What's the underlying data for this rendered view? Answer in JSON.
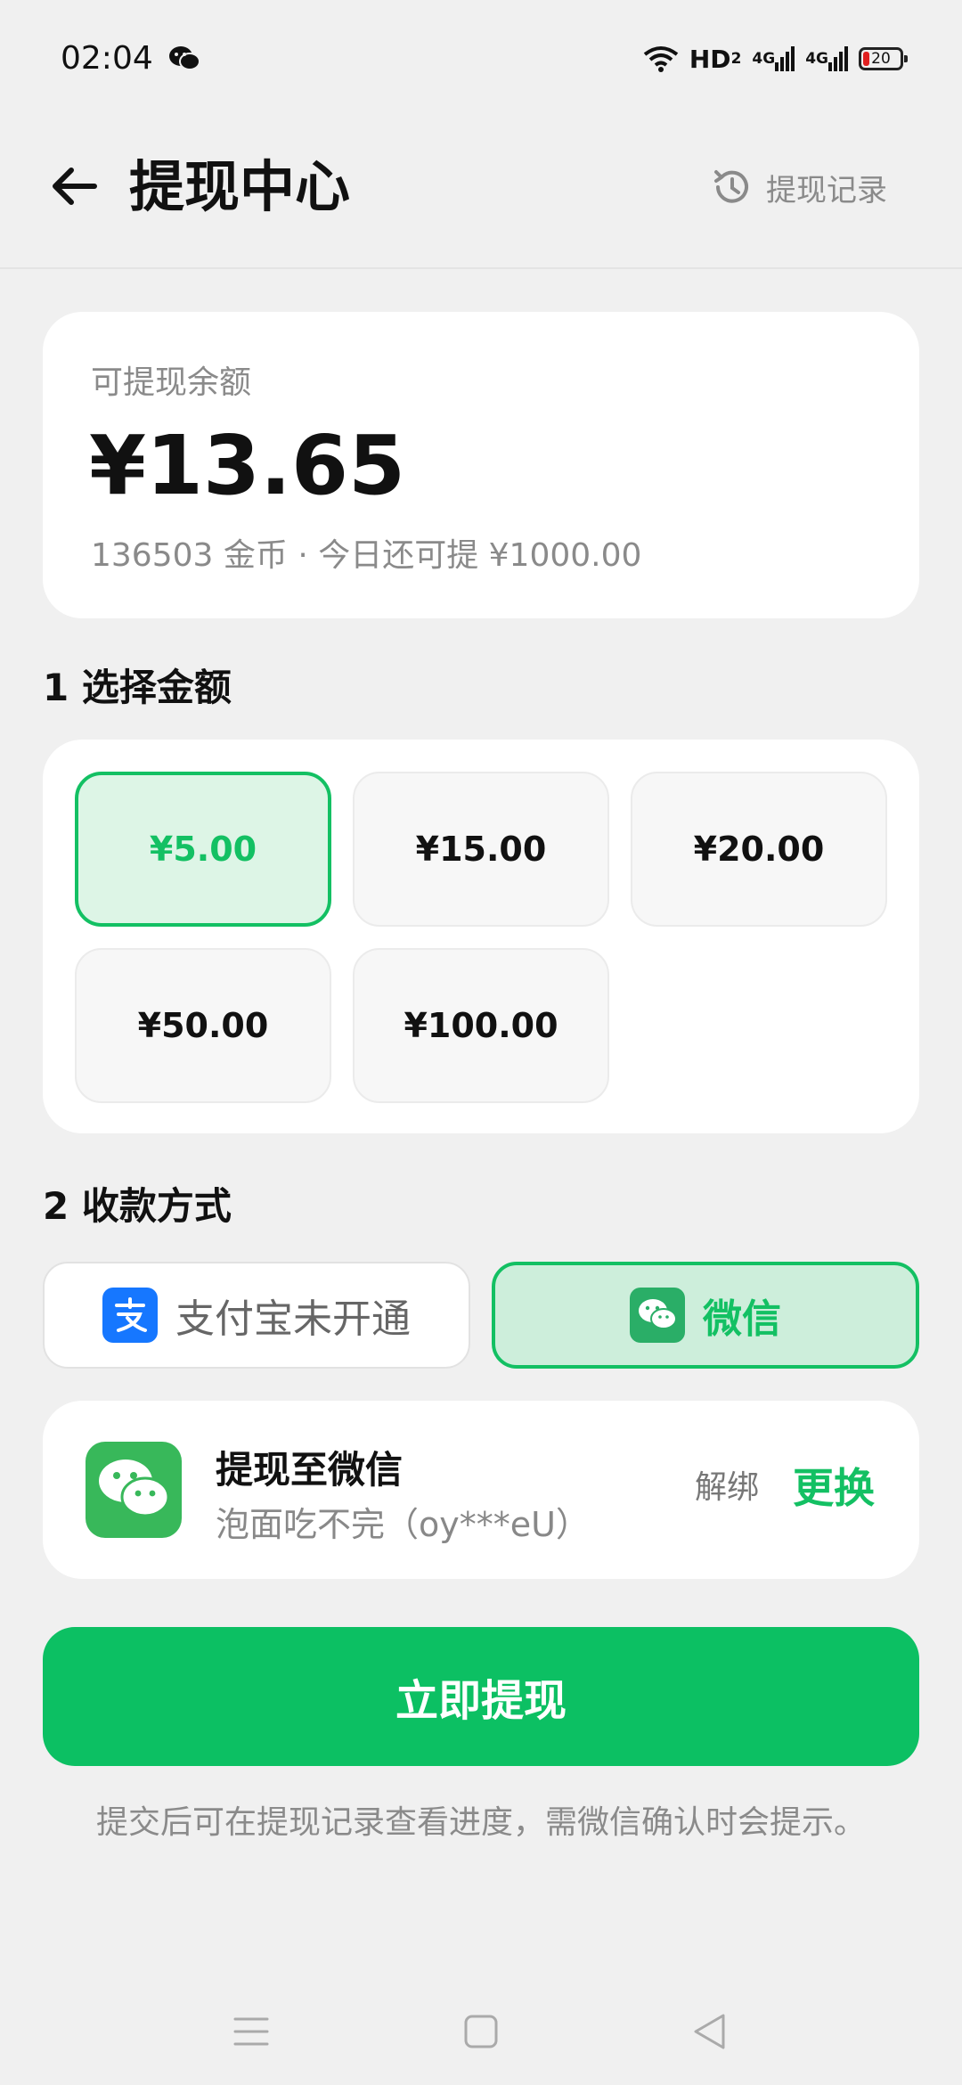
{
  "status_bar": {
    "time": "02:04",
    "network": "HD",
    "network_sub": "2",
    "signal_1": "4G",
    "signal_2": "4G",
    "battery": "20"
  },
  "header": {
    "title": "提现中心",
    "history_label": "提现记录"
  },
  "balance": {
    "label": "可提现余额",
    "amount": "¥13.65",
    "sub": "136503 金币 · 今日还可提 ¥1000.00"
  },
  "amount_section": {
    "title": "1 选择金额",
    "options": [
      "¥5.00",
      "¥15.00",
      "¥20.00",
      "¥50.00",
      "¥100.00"
    ],
    "selected": "¥5.00"
  },
  "payment_section": {
    "title": "2 收款方式",
    "alipay_label": "支付宝未开通",
    "wechat_label": "微信",
    "selected": "微信"
  },
  "account": {
    "title": "提现至微信",
    "sub": "泡面吃不完（oy***eU）",
    "unbind_label": "解绑",
    "change_label": "更换"
  },
  "submit_label": "立即提现",
  "hint": "提交后可在提现记录查看进度，需微信确认时会提示。",
  "colors": {
    "accent": "#13c063",
    "background": "#f0f0f0",
    "card": "#ffffff",
    "alipay": "#1677ff"
  }
}
